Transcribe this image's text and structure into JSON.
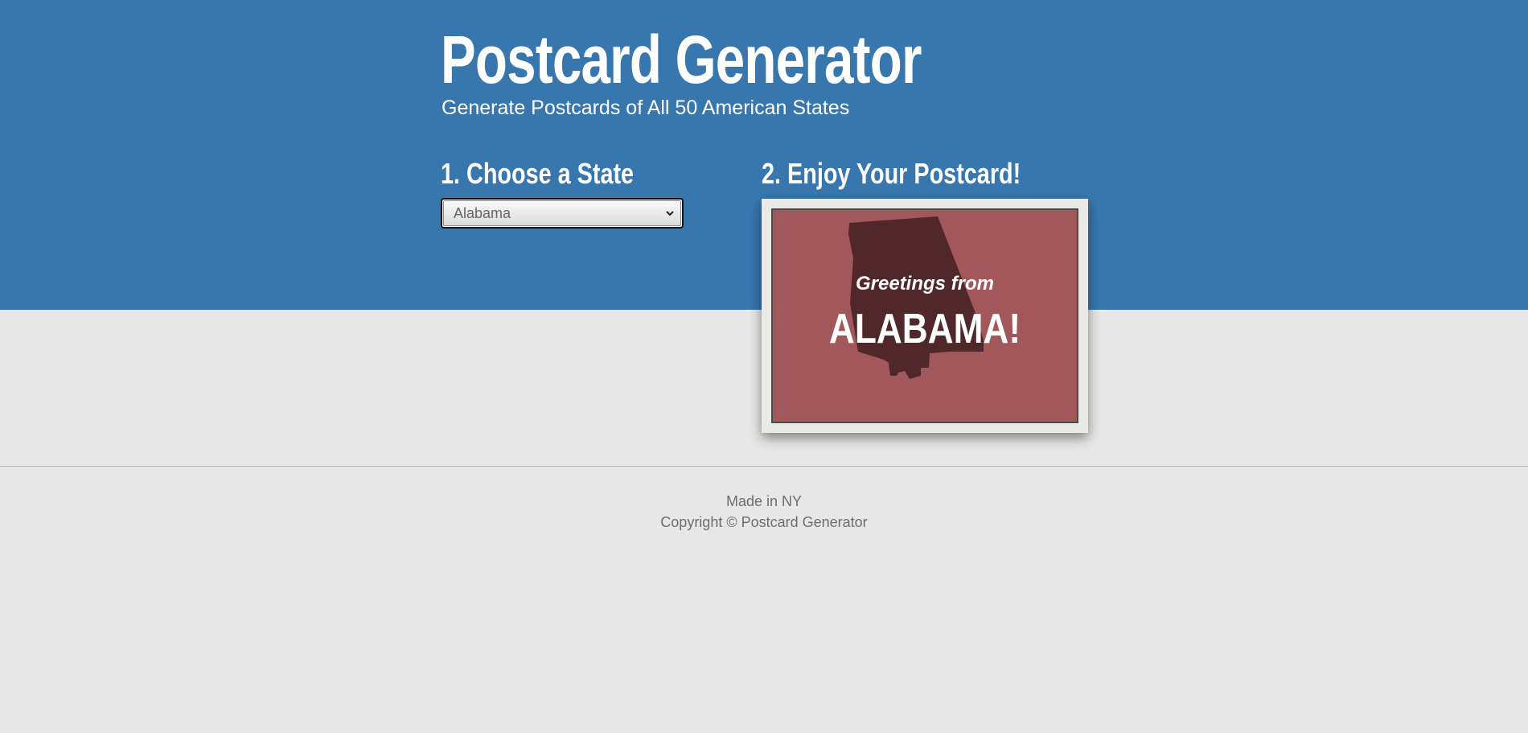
{
  "header": {
    "title": "Postcard Generator",
    "subtitle": "Generate Postcards of All 50 American States"
  },
  "steps": {
    "choose_heading": "1. Choose a State",
    "enjoy_heading": "2. Enjoy Your Postcard!"
  },
  "state_select": {
    "selected": "Alabama",
    "icon": "chevron-down-icon"
  },
  "postcard": {
    "greeting": "Greetings from",
    "state_name": "ALABAMA!",
    "state_shape_icon": "alabama-silhouette-icon"
  },
  "footer": {
    "made_in": "Made in NY",
    "copyright": "Copyright © Postcard Generator"
  },
  "colors": {
    "hero_bg": "#3877ae",
    "page_bg": "#e7e7e7",
    "card_bg": "#a2575a",
    "silhouette": "#50282b"
  }
}
